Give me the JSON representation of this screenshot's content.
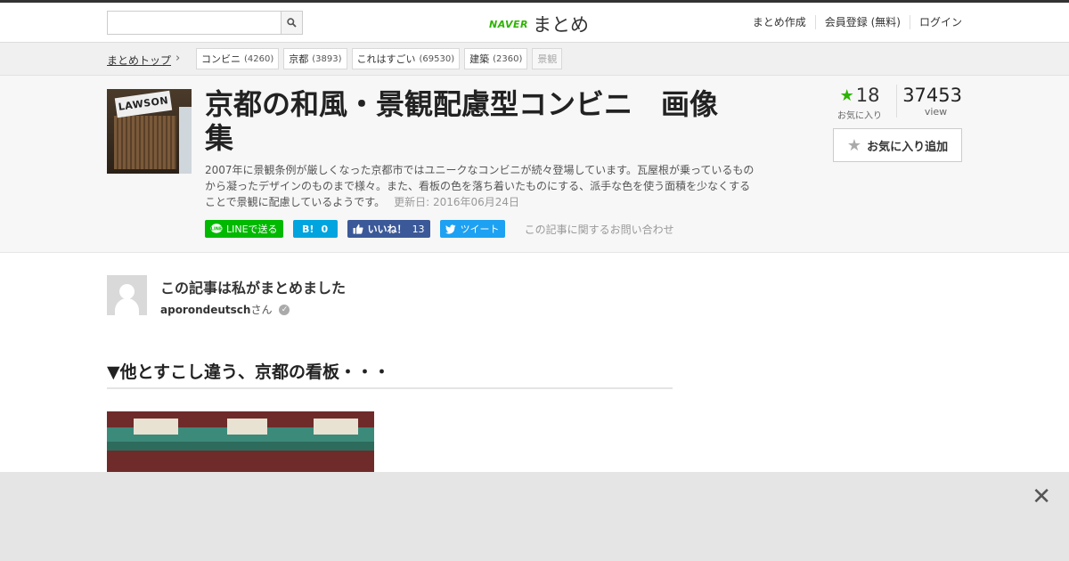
{
  "header": {
    "search": {
      "placeholder": "",
      "value": ""
    },
    "logo": {
      "brand": "NAVER",
      "product": "まとめ"
    },
    "nav": [
      "まとめ作成",
      "会員登録 (無料)",
      "ログイン"
    ]
  },
  "breadcrumb": {
    "top": "まとめトップ",
    "tags": [
      {
        "label": "コンビニ",
        "count": "(4260)"
      },
      {
        "label": "京都",
        "count": "(3893)"
      },
      {
        "label": "これはすごい",
        "count": "(69530)"
      },
      {
        "label": "建築",
        "count": "(2360)"
      },
      {
        "label": "景観",
        "count": ""
      }
    ]
  },
  "article": {
    "thumb_sign": "LAWSON",
    "title": "京都の和風・景観配慮型コンビニ　画像集",
    "description": "2007年に景観条例が厳しくなった京都市ではユニークなコンビニが続々登場しています。瓦屋根が乗っているものから凝ったデザインのものまで様々。また、看板の色を落ち着いたものにする、派手な色を使う面積を少なくすることで景観に配慮しているようです。",
    "updated": "更新日: 2016年06月24日",
    "share": {
      "line": "LINEで送る",
      "hatena_icon": "B!",
      "hatena_count": "0",
      "facebook": "いいね！",
      "facebook_count": "13",
      "twitter": "ツイート"
    },
    "contact": "この記事に関するお問い合わせ",
    "favorites": {
      "count": "18",
      "label": "お気に入り"
    },
    "views": {
      "count": "37453",
      "label": "view"
    },
    "fav_button": "お気に入り追加"
  },
  "author": {
    "heading": "この記事は私がまとめました",
    "name": "aporondeutsch",
    "suffix": "さん"
  },
  "section": {
    "heading": "▼他とすこし違う、京都の看板・・・"
  },
  "icons": {
    "search": "search-icon",
    "chevron": "chevron-right-icon",
    "star": "star-icon",
    "check": "verified-icon",
    "close": "close-icon"
  },
  "colors": {
    "accent": "#2db400",
    "line": "#00b900",
    "hatena": "#00a4de",
    "facebook": "#3b5998",
    "twitter": "#1da1f2"
  }
}
